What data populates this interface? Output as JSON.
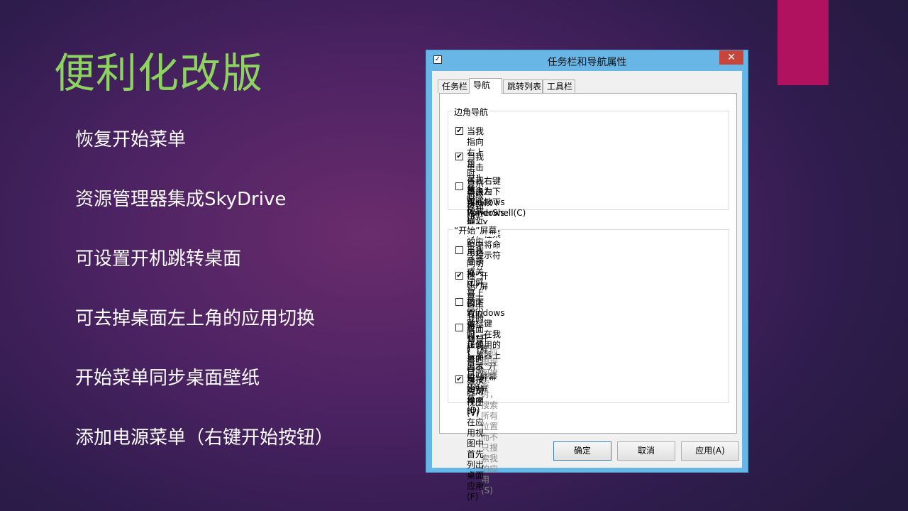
{
  "slide": {
    "title": "便利化改版",
    "bullets": [
      "恢复开始菜单",
      "资源管理器集成SkyDrive",
      "可设置开机跳转桌面",
      "可去掉桌面左上角的应用切换",
      "开始菜单同步桌面壁纸",
      "添加电源菜单（右键开始按钮）"
    ]
  },
  "dialog": {
    "title": "任务栏和导航属性",
    "close_glyph": "✕",
    "tabs": [
      {
        "label": "任务栏",
        "active": false
      },
      {
        "label": "导航",
        "active": true
      },
      {
        "label": "跳转列表",
        "active": false
      },
      {
        "label": "工具栏",
        "active": false
      }
    ],
    "group_corner": {
      "label": "边角导航",
      "options": [
        {
          "line1": "当我指向右上角时，显示超级按钮(R)",
          "checked": true
        },
        {
          "line1": "当我单击左上角时，在我最近使用的应用之间切换(L)",
          "checked": true
        },
        {
          "line1": "当我右键单击左下角或按下 Windows 键+X 时，在菜单中将命令提示符",
          "line2": "替换为 Windows PowerShell(C)",
          "checked": false
        }
      ]
    },
    "group_start": {
      "label": "“开始”屏幕",
      "options": [
        {
          "line1": "当我登录或关闭屏幕上的所有应用时，转到桌面而不是“开始”屏幕(D)",
          "checked": false
        },
        {
          "line1": "在“开始”屏幕上显示我的桌面背景(B)",
          "checked": true
        },
        {
          "line1": "按下 Windows 徽标键时，在我正使用的显示器上显示“开始”屏幕(U)",
          "checked": false
        },
        {
          "line1": "转到“开始”屏幕时自动显示应用视图(V)",
          "checked": false
        },
        {
          "line1": "从应用视图搜索时，搜索所有位置而不只搜索我的应用(S)",
          "checked": false,
          "disabled": true
        },
        {
          "line1": "当按类别排序时，在应用视图中首先列出桌面应用(F)",
          "checked": true
        }
      ]
    },
    "buttons": {
      "ok": "确定",
      "cancel": "取消",
      "apply": "应用(A)"
    },
    "check_glyph": "✔"
  }
}
